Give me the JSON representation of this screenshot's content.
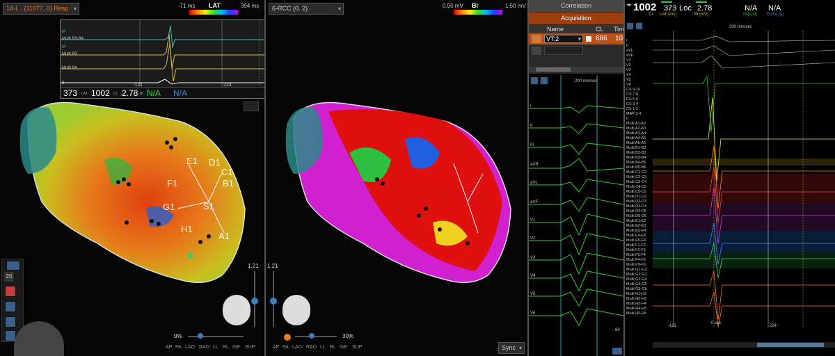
{
  "left_map": {
    "map_select": "14-I... (11077, 0) Resp",
    "scale_title": "LAT",
    "scale_min": "-71 ms",
    "scale_max": "394 ms",
    "popup": {
      "channels": [
        "M",
        "Multi B3-B4",
        "M",
        "Multi B3",
        "Multi B4",
        "II"
      ],
      "time_left": "-121",
      "time_right": "224",
      "readout": {
        "lat": "373",
        "lat_unit": "LAT",
        "cl": "1002",
        "cl_unit": "CL",
        "bi": "2.78",
        "bi_unit": "Bi",
        "imp": "N/A",
        "force": "N/A"
      }
    },
    "labels": [
      "E1",
      "D1",
      "C1",
      "B1",
      "F1",
      "G1",
      "S1",
      "H1",
      "A1"
    ],
    "zoom_value": "1.21",
    "opacity": "0%",
    "views": [
      "AP",
      "PA",
      "LAO",
      "RAO",
      "LL",
      "RL",
      "INF",
      "SUP"
    ],
    "tool_number": "20"
  },
  "mid_map": {
    "map_select": "6-RCC (0, 2)",
    "scale_title": "Bi",
    "scale_min": "0.50 mV",
    "scale_max": "1.50 mV",
    "zoom_value": "1.21",
    "opacity": "30%",
    "views": [
      "AP",
      "PA",
      "LAO",
      "RAO",
      "LL",
      "RL",
      "INF",
      "SUP"
    ],
    "sync_label": "Sync"
  },
  "control_panel": {
    "tabs": [
      "Correlation",
      "Acquisition"
    ],
    "columns": [
      "Name",
      "CL",
      "Tim"
    ],
    "row": {
      "name": "VT:2",
      "cl": "686",
      "time": "10"
    }
  },
  "ecg_panel": {
    "speed": "200 mm/sec",
    "leads": [
      "I",
      "II",
      "III",
      "aVR",
      "aVL",
      "aVF",
      "V1",
      "V2",
      "V3",
      "V4",
      "V5",
      "V6"
    ],
    "bottom_value": "60"
  },
  "egm_panel": {
    "header": {
      "cl_value": "1002",
      "cl_label": "CL",
      "lat_value": "373",
      "lat_label": "LAT (ms)",
      "loc_label": "Loc",
      "bi_value": "2.78",
      "bi_label": "Bi (mV)",
      "imp_value": "N/A",
      "imp_label": "Imp (Ω)",
      "force_value": "N/A",
      "force_label": "Force (g)"
    },
    "speed": "200 mm/sec",
    "channels": [
      "I",
      "II",
      "aVL",
      "aVF",
      "V1",
      "V2",
      "V3",
      "V4",
      "V5",
      "V6",
      "CS 9-10",
      "CS 7-8",
      "CS 5-6",
      "CS 3-4",
      "CS 1-2",
      "MAP 3-4",
      "II",
      "Multi A1-A2",
      "Multi A2-A3",
      "Multi A3-A4",
      "Multi A4-A5",
      "Multi A5-A6",
      "Multi B1-B2",
      "Multi B2-B3",
      "Multi B3-B4",
      "Multi B4-B5",
      "Multi B5-B6",
      "Multi C1-C2",
      "Multi C2-C3",
      "Multi C3-C4",
      "Multi C4-C5",
      "Multi C5-C6",
      "Multi D1-D2",
      "Multi D2-D3",
      "Multi D3-D4",
      "Multi D4-D5",
      "Multi D5-D6",
      "Multi E1-E2",
      "Multi E2-E3",
      "Multi E3-E4",
      "Multi E4-E5",
      "Multi E5-E6",
      "Multi F1-F2",
      "Multi F2-F3",
      "Multi F3-F4",
      "Multi F4-F5",
      "Multi F5-F6",
      "Multi G1-G2",
      "Multi G2-G3",
      "Multi G3-G4",
      "Multi G4-G5",
      "Multi G5-G6",
      "Multi H1-H2",
      "Multi H2-H3",
      "Multi H3-H4",
      "Multi H4-H5",
      "Multi H5-H6"
    ],
    "time_left": "-121",
    "time_zero": "0 sec",
    "time_right": "224"
  }
}
